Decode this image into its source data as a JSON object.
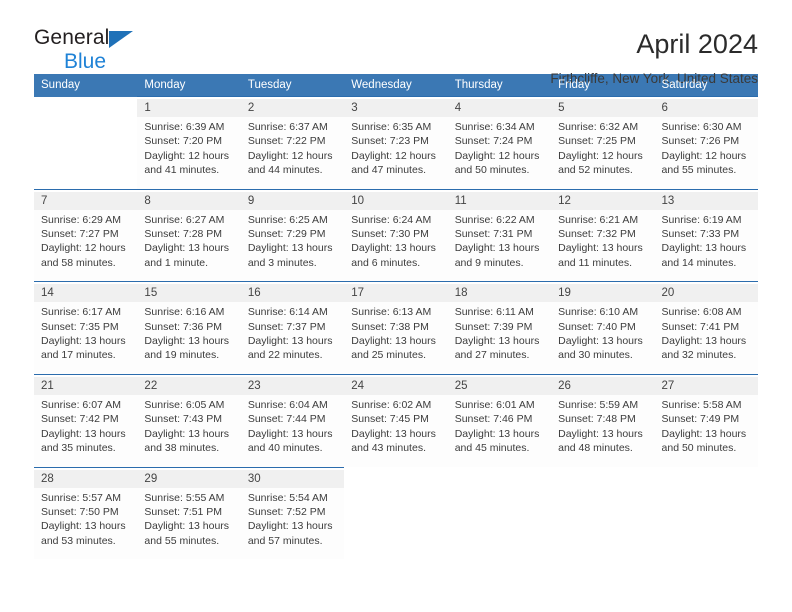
{
  "brand": {
    "name_top": "General",
    "name_bottom": "Blue",
    "triangle_color": "#1f71b8",
    "blue_color": "#1f82d6"
  },
  "header": {
    "title": "April 2024",
    "subtitle": "Firthcliffe, New York, United States"
  },
  "theme": {
    "header_bg": "#3b78b4",
    "week_rule": "#2b6cad",
    "daynum_bg": "#f0f0f0"
  },
  "weekdays": [
    "Sunday",
    "Monday",
    "Tuesday",
    "Wednesday",
    "Thursday",
    "Friday",
    "Saturday"
  ],
  "labels": {
    "sunrise": "Sunrise:",
    "sunset": "Sunset:",
    "daylight": "Daylight:"
  },
  "weeks": [
    [
      {
        "day": "",
        "lines": []
      },
      {
        "day": "1",
        "lines": [
          "Sunrise: 6:39 AM",
          "Sunset: 7:20 PM",
          "Daylight: 12 hours",
          "and 41 minutes."
        ]
      },
      {
        "day": "2",
        "lines": [
          "Sunrise: 6:37 AM",
          "Sunset: 7:22 PM",
          "Daylight: 12 hours",
          "and 44 minutes."
        ]
      },
      {
        "day": "3",
        "lines": [
          "Sunrise: 6:35 AM",
          "Sunset: 7:23 PM",
          "Daylight: 12 hours",
          "and 47 minutes."
        ]
      },
      {
        "day": "4",
        "lines": [
          "Sunrise: 6:34 AM",
          "Sunset: 7:24 PM",
          "Daylight: 12 hours",
          "and 50 minutes."
        ]
      },
      {
        "day": "5",
        "lines": [
          "Sunrise: 6:32 AM",
          "Sunset: 7:25 PM",
          "Daylight: 12 hours",
          "and 52 minutes."
        ]
      },
      {
        "day": "6",
        "lines": [
          "Sunrise: 6:30 AM",
          "Sunset: 7:26 PM",
          "Daylight: 12 hours",
          "and 55 minutes."
        ]
      }
    ],
    [
      {
        "day": "7",
        "lines": [
          "Sunrise: 6:29 AM",
          "Sunset: 7:27 PM",
          "Daylight: 12 hours",
          "and 58 minutes."
        ]
      },
      {
        "day": "8",
        "lines": [
          "Sunrise: 6:27 AM",
          "Sunset: 7:28 PM",
          "Daylight: 13 hours",
          "and 1 minute."
        ]
      },
      {
        "day": "9",
        "lines": [
          "Sunrise: 6:25 AM",
          "Sunset: 7:29 PM",
          "Daylight: 13 hours",
          "and 3 minutes."
        ]
      },
      {
        "day": "10",
        "lines": [
          "Sunrise: 6:24 AM",
          "Sunset: 7:30 PM",
          "Daylight: 13 hours",
          "and 6 minutes."
        ]
      },
      {
        "day": "11",
        "lines": [
          "Sunrise: 6:22 AM",
          "Sunset: 7:31 PM",
          "Daylight: 13 hours",
          "and 9 minutes."
        ]
      },
      {
        "day": "12",
        "lines": [
          "Sunrise: 6:21 AM",
          "Sunset: 7:32 PM",
          "Daylight: 13 hours",
          "and 11 minutes."
        ]
      },
      {
        "day": "13",
        "lines": [
          "Sunrise: 6:19 AM",
          "Sunset: 7:33 PM",
          "Daylight: 13 hours",
          "and 14 minutes."
        ]
      }
    ],
    [
      {
        "day": "14",
        "lines": [
          "Sunrise: 6:17 AM",
          "Sunset: 7:35 PM",
          "Daylight: 13 hours",
          "and 17 minutes."
        ]
      },
      {
        "day": "15",
        "lines": [
          "Sunrise: 6:16 AM",
          "Sunset: 7:36 PM",
          "Daylight: 13 hours",
          "and 19 minutes."
        ]
      },
      {
        "day": "16",
        "lines": [
          "Sunrise: 6:14 AM",
          "Sunset: 7:37 PM",
          "Daylight: 13 hours",
          "and 22 minutes."
        ]
      },
      {
        "day": "17",
        "lines": [
          "Sunrise: 6:13 AM",
          "Sunset: 7:38 PM",
          "Daylight: 13 hours",
          "and 25 minutes."
        ]
      },
      {
        "day": "18",
        "lines": [
          "Sunrise: 6:11 AM",
          "Sunset: 7:39 PM",
          "Daylight: 13 hours",
          "and 27 minutes."
        ]
      },
      {
        "day": "19",
        "lines": [
          "Sunrise: 6:10 AM",
          "Sunset: 7:40 PM",
          "Daylight: 13 hours",
          "and 30 minutes."
        ]
      },
      {
        "day": "20",
        "lines": [
          "Sunrise: 6:08 AM",
          "Sunset: 7:41 PM",
          "Daylight: 13 hours",
          "and 32 minutes."
        ]
      }
    ],
    [
      {
        "day": "21",
        "lines": [
          "Sunrise: 6:07 AM",
          "Sunset: 7:42 PM",
          "Daylight: 13 hours",
          "and 35 minutes."
        ]
      },
      {
        "day": "22",
        "lines": [
          "Sunrise: 6:05 AM",
          "Sunset: 7:43 PM",
          "Daylight: 13 hours",
          "and 38 minutes."
        ]
      },
      {
        "day": "23",
        "lines": [
          "Sunrise: 6:04 AM",
          "Sunset: 7:44 PM",
          "Daylight: 13 hours",
          "and 40 minutes."
        ]
      },
      {
        "day": "24",
        "lines": [
          "Sunrise: 6:02 AM",
          "Sunset: 7:45 PM",
          "Daylight: 13 hours",
          "and 43 minutes."
        ]
      },
      {
        "day": "25",
        "lines": [
          "Sunrise: 6:01 AM",
          "Sunset: 7:46 PM",
          "Daylight: 13 hours",
          "and 45 minutes."
        ]
      },
      {
        "day": "26",
        "lines": [
          "Sunrise: 5:59 AM",
          "Sunset: 7:48 PM",
          "Daylight: 13 hours",
          "and 48 minutes."
        ]
      },
      {
        "day": "27",
        "lines": [
          "Sunrise: 5:58 AM",
          "Sunset: 7:49 PM",
          "Daylight: 13 hours",
          "and 50 minutes."
        ]
      }
    ],
    [
      {
        "day": "28",
        "lines": [
          "Sunrise: 5:57 AM",
          "Sunset: 7:50 PM",
          "Daylight: 13 hours",
          "and 53 minutes."
        ]
      },
      {
        "day": "29",
        "lines": [
          "Sunrise: 5:55 AM",
          "Sunset: 7:51 PM",
          "Daylight: 13 hours",
          "and 55 minutes."
        ]
      },
      {
        "day": "30",
        "lines": [
          "Sunrise: 5:54 AM",
          "Sunset: 7:52 PM",
          "Daylight: 13 hours",
          "and 57 minutes."
        ]
      },
      {
        "day": "",
        "lines": []
      },
      {
        "day": "",
        "lines": []
      },
      {
        "day": "",
        "lines": []
      },
      {
        "day": "",
        "lines": []
      }
    ]
  ]
}
